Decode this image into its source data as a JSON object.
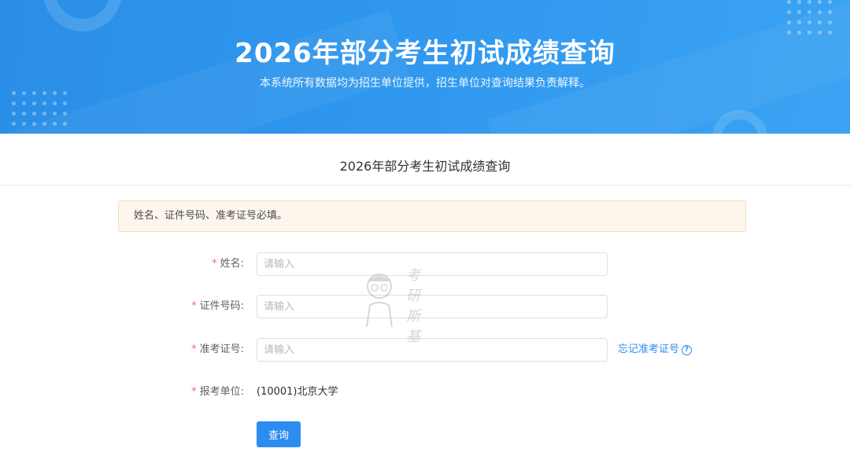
{
  "banner": {
    "title": "2026年部分考生初试成绩查询",
    "subtitle": "本系统所有数据均为招生单位提供，招生单位对查询结果负责解释。"
  },
  "section_title": "2026年部分考生初试成绩查询",
  "alert": {
    "text": "姓名、证件号码、准考证号必填。"
  },
  "form": {
    "required_mark": "*",
    "name": {
      "label": "姓名:",
      "placeholder": "请输入",
      "value": ""
    },
    "id_number": {
      "label": "证件号码:",
      "placeholder": "请输入",
      "value": ""
    },
    "exam_number": {
      "label": "准考证号:",
      "placeholder": "请输入",
      "value": "",
      "forgot_link": "忘记准考证号"
    },
    "unit": {
      "label": "报考单位:",
      "value": "(10001)北京大学"
    },
    "submit_label": "查询"
  },
  "watermark": {
    "text": "考研斯基"
  },
  "icons": {
    "help": "question-circle-icon"
  },
  "colors": {
    "banner": "#2f97ee",
    "primary": "#2d8cf0",
    "required": "#f56c6c",
    "alert_bg": "#fdf6ec"
  }
}
